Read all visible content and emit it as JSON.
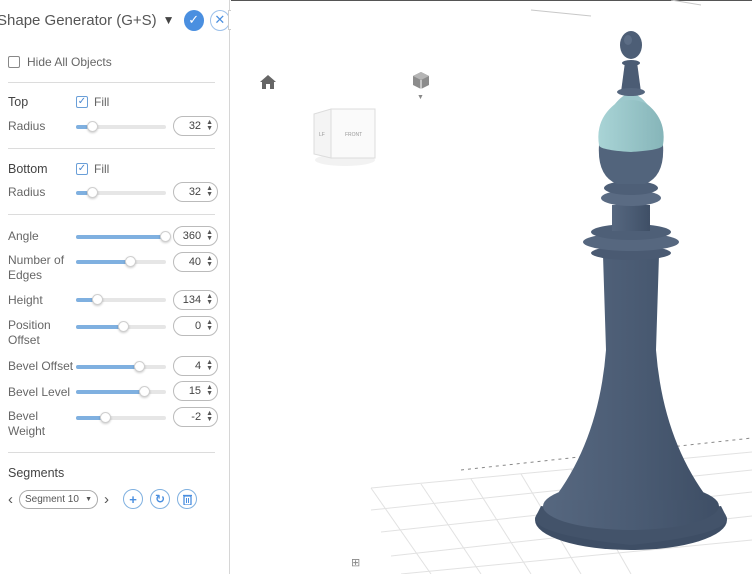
{
  "panel": {
    "title": "Shape Generator (G+S)",
    "title_caret": "▼",
    "ok_icon": "check-icon",
    "close_icon": "close-icon",
    "hide_all_label": "Hide All Objects",
    "top": {
      "heading": "Top",
      "fill_label": "Fill",
      "radius_label": "Radius",
      "radius_value": "32"
    },
    "bottom": {
      "heading": "Bottom",
      "fill_label": "Fill",
      "radius_label": "Radius",
      "radius_value": "32"
    },
    "params": [
      {
        "label": "Angle",
        "value": "360",
        "level": 1.0
      },
      {
        "label": "Number of Edges",
        "value": "40",
        "level": 0.6
      },
      {
        "label": "Height",
        "value": "134",
        "level": 0.2
      },
      {
        "label": "Position Offset",
        "value": "0",
        "level": 0.5
      },
      {
        "label": "Bevel Offset",
        "value": "4",
        "level": 0.7
      },
      {
        "label": "Bevel Level",
        "value": "15",
        "level": 0.75
      },
      {
        "label": "Bevel Weight",
        "value": "-2",
        "level": 0.3
      }
    ],
    "segments": {
      "heading": "Segments",
      "selected": "Segment 10"
    }
  },
  "viewport": {
    "navcube_face_left": "LF",
    "navcube_face_front": "FRONT"
  },
  "colors": {
    "accent": "#4a8fe0",
    "slider_fill": "#7fb0e0",
    "model": "#4e5f78",
    "highlight": "#9cc8cc"
  }
}
